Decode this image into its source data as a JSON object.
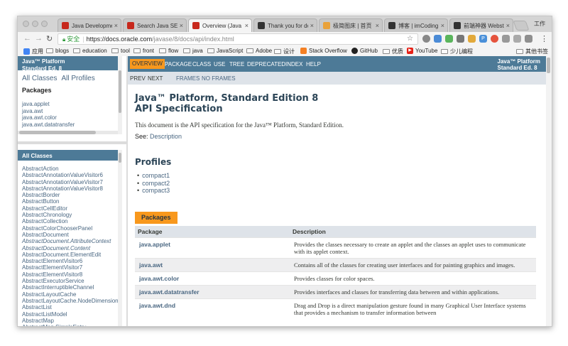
{
  "browser": {
    "tabs": [
      {
        "label": "Java Development",
        "favicon": "red",
        "active": false
      },
      {
        "label": "Search Java SE Do",
        "favicon": "red",
        "active": false
      },
      {
        "label": "Overview (Java Pl",
        "favicon": "red",
        "active": true
      },
      {
        "label": "Thank you for dow",
        "favicon": "dark",
        "active": false
      },
      {
        "label": "极简图床 | 首页",
        "favicon": "multi",
        "active": false
      },
      {
        "label": "博客 | imCoding",
        "favicon": "dark",
        "active": false
      },
      {
        "label": "前端神器 Webstorm",
        "favicon": "dark",
        "active": false
      }
    ],
    "tab_close": "×",
    "window_label": "工作",
    "address": {
      "secure_label": "安全",
      "url_host": "https://docs.oracle.com",
      "url_path": "/javase/8/docs/api/index.html"
    },
    "bookmarks": [
      "应用",
      "blogs",
      "education",
      "tool",
      "front",
      "flow",
      "java",
      "JavaScript",
      "Adobe",
      "设计",
      "Stack Overflow",
      "GitHub",
      "优质",
      "YouTube",
      "少儿编程",
      "其他书签"
    ]
  },
  "left_top": {
    "header_line1": "Java™ Platform",
    "header_line2": "Standard Ed. 8",
    "links": [
      "All Classes",
      "All Profiles"
    ],
    "heading": "Packages",
    "packages": [
      "java.applet",
      "java.awt",
      "java.awt.color",
      "java.awt.datatransfer"
    ]
  },
  "left_bottom": {
    "header": "All Classes",
    "classes": [
      "AbstractAction",
      "AbstractAnnotationValueVisitor6",
      "AbstractAnnotationValueVisitor7",
      "AbstractAnnotationValueVisitor8",
      "AbstractBorder",
      "AbstractButton",
      "AbstractCellEditor",
      "AbstractChronology",
      "AbstractCollection",
      "AbstractColorChooserPanel",
      "AbstractDocument",
      "AbstractDocument.AttributeContext",
      "AbstractDocument.Content",
      "AbstractDocument.ElementEdit",
      "AbstractElementVisitor6",
      "AbstractElementVisitor7",
      "AbstractElementVisitor8",
      "AbstractExecutorService",
      "AbstractInterruptibleChannel",
      "AbstractLayoutCache",
      "AbstractLayoutCache.NodeDimensions",
      "AbstractList",
      "AbstractListModel",
      "AbstractMap",
      "AbstractMap.SimpleEntry"
    ],
    "italic": [
      "AbstractDocument.AttributeContext",
      "AbstractDocument.Content"
    ]
  },
  "main": {
    "nav": [
      "OVERVIEW",
      "PACKAGE",
      "CLASS",
      "USE",
      "TREE",
      "DEPRECATED",
      "INDEX",
      "HELP"
    ],
    "about_line1": "Java™ Platform",
    "about_line2": "Standard Ed. 8",
    "subnav": [
      "PREV",
      "NEXT",
      "FRAMES",
      "NO FRAMES"
    ],
    "title_line1": "Java™ Platform, Standard Edition 8",
    "title_line2": "API Specification",
    "description": "This document is the API specification for the Java™ Platform, Standard Edition.",
    "see_label": "See:",
    "see_link": "Description",
    "profiles_heading": "Profiles",
    "profiles": [
      "compact1",
      "compact2",
      "compact3"
    ],
    "packages_caption": "Packages",
    "table_headers": [
      "Package",
      "Description"
    ],
    "packages": [
      {
        "name": "java.applet",
        "desc": "Provides the classes necessary to create an applet and the classes an applet uses to communicate with its applet context."
      },
      {
        "name": "java.awt",
        "desc": "Contains all of the classes for creating user interfaces and for painting graphics and images."
      },
      {
        "name": "java.awt.color",
        "desc": "Provides classes for color spaces."
      },
      {
        "name": "java.awt.datatransfer",
        "desc": "Provides interfaces and classes for transferring data between and within applications."
      },
      {
        "name": "java.awt.dnd",
        "desc": "Drag and Drop is a direct manipulation gesture found in many Graphical User Interface systems that provides a mechanism to transfer information between"
      }
    ]
  },
  "colors": {
    "java_blue": "#4d7a97",
    "java_orange": "#f8981d",
    "link": "#4a6782"
  }
}
